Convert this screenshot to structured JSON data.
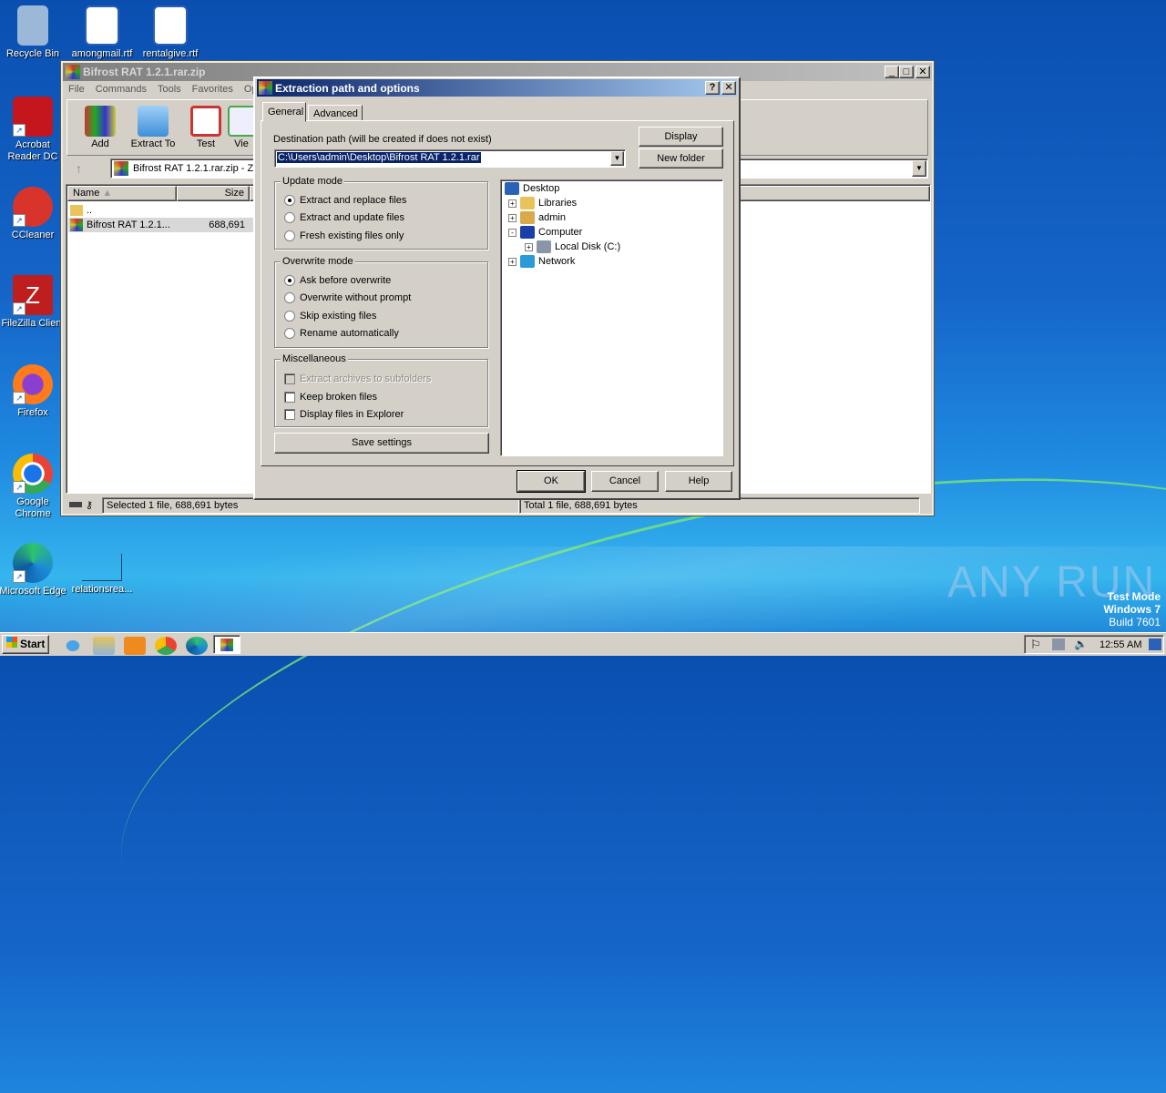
{
  "desktop": {
    "icons": [
      {
        "label": "Recycle Bin",
        "color": "#7aa0c8"
      },
      {
        "label": "amongmail.rtf",
        "color": "#2b5fb4"
      },
      {
        "label": "rentalgive.rtf",
        "color": "#2b5fb4"
      },
      {
        "label": "Acrobat Reader DC",
        "color": "#c4161c"
      },
      {
        "label": "CCleaner",
        "color": "#d9342b"
      },
      {
        "label": "FileZilla Client",
        "color": "#bf1e1e"
      },
      {
        "label": "Firefox",
        "color": "#ff7b1c"
      },
      {
        "label": "Google Chrome",
        "color": "#3aa757"
      },
      {
        "label": "Microsoft Edge",
        "color": "#1b8ad6"
      },
      {
        "label": "relationsrea...",
        "color": "#1e6fc4"
      }
    ],
    "watermark": "ANY RUN",
    "os_info": [
      "Test Mode",
      "Windows 7",
      "Build 7601"
    ]
  },
  "winrar": {
    "title": "Bifrost RAT 1.2.1.rar.zip",
    "menu": [
      "File",
      "Commands",
      "Tools",
      "Favorites",
      "Opt"
    ],
    "toolbar": [
      "Add",
      "Extract To",
      "Test",
      "Vie"
    ],
    "address": "Bifrost RAT 1.2.1.rar.zip - Z",
    "columns": [
      "Name",
      "Size"
    ],
    "rows": [
      {
        "name": "..",
        "size": ""
      },
      {
        "name": "Bifrost RAT 1.2.1...",
        "size": "688,691"
      }
    ],
    "status_left": "Selected 1 file, 688,691 bytes",
    "status_right": "Total 1 file, 688,691 bytes"
  },
  "dialog": {
    "title": "Extraction path and options",
    "help_btn": "?",
    "close_btn": "✕",
    "tabs": [
      "General",
      "Advanced"
    ],
    "dest_label": "Destination path (will be created if does not exist)",
    "dest_value": "C:\\Users\\admin\\Desktop\\Bifrost RAT 1.2.1.rar",
    "display_btn": "Display",
    "new_folder_btn": "New folder",
    "update_mode": {
      "label": "Update mode",
      "options": [
        "Extract and replace files",
        "Extract and update files",
        "Fresh existing files only"
      ],
      "selected": 0
    },
    "overwrite_mode": {
      "label": "Overwrite mode",
      "options": [
        "Ask before overwrite",
        "Overwrite without prompt",
        "Skip existing files",
        "Rename automatically"
      ],
      "selected": 0
    },
    "misc": {
      "label": "Miscellaneous",
      "options": [
        {
          "label": "Extract archives to subfolders",
          "checked": false,
          "disabled": true
        },
        {
          "label": "Keep broken files",
          "checked": false,
          "disabled": false
        },
        {
          "label": "Display files in Explorer",
          "checked": false,
          "disabled": false
        }
      ]
    },
    "save_settings": "Save settings",
    "tree": [
      {
        "label": "Desktop",
        "expander": ""
      },
      {
        "label": "Libraries",
        "expander": "+"
      },
      {
        "label": "admin",
        "expander": "+"
      },
      {
        "label": "Computer",
        "expander": "-"
      },
      {
        "label": "Local Disk (C:)",
        "expander": "+"
      },
      {
        "label": "Network",
        "expander": "+"
      }
    ],
    "ok": "OK",
    "cancel": "Cancel",
    "help": "Help"
  },
  "taskbar": {
    "start": "Start",
    "clock": "12:55 AM"
  }
}
